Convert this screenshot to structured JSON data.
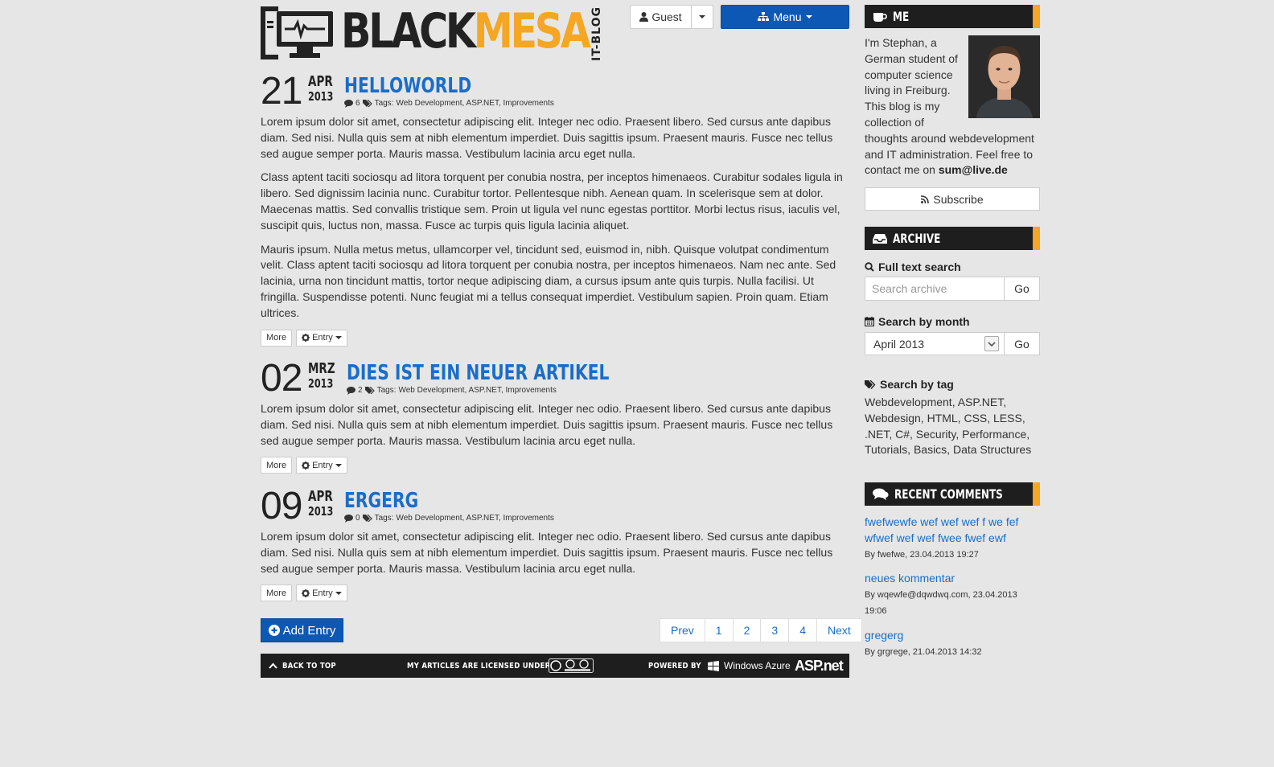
{
  "brand": {
    "black": "BLACK",
    "mesa": "MESA",
    "sub": "IT-BLOG"
  },
  "header": {
    "guest_label": "Guest",
    "menu_label": "Menu"
  },
  "posts": [
    {
      "day": "21",
      "month": "APR",
      "year": "2013",
      "title": "HELLOWORLD",
      "comments": "6",
      "tags_label": "Tags:",
      "tags": "Web Development, ASP.NET, Improvements",
      "paragraphs": [
        "Lorem ipsum dolor sit amet, consectetur adipiscing elit. Integer nec odio. Praesent libero. Sed cursus ante dapibus diam. Sed nisi. Nulla quis sem at nibh elementum imperdiet. Duis sagittis ipsum. Praesent mauris. Fusce nec tellus sed augue semper porta. Mauris massa. Vestibulum lacinia arcu eget nulla.",
        "Class aptent taciti sociosqu ad litora torquent per conubia nostra, per inceptos himenaeos. Curabitur sodales ligula in libero. Sed dignissim lacinia nunc. Curabitur tortor. Pellentesque nibh. Aenean quam. In scelerisque sem at dolor. Maecenas mattis. Sed convallis tristique sem. Proin ut ligula vel nunc egestas porttitor. Morbi lectus risus, iaculis vel, suscipit quis, luctus non, massa. Fusce ac turpis quis ligula lacinia aliquet.",
        "Mauris ipsum. Nulla metus metus, ullamcorper vel, tincidunt sed, euismod in, nibh. Quisque volutpat condimentum velit. Class aptent taciti sociosqu ad litora torquent per conubia nostra, per inceptos himenaeos. Nam nec ante. Sed lacinia, urna non tincidunt mattis, tortor neque adipiscing diam, a cursus ipsum ante quis turpis. Nulla facilisi. Ut fringilla. Suspendisse potenti. Nunc feugiat mi a tellus consequat imperdiet. Vestibulum sapien. Proin quam. Etiam ultrices."
      ],
      "more_label": "More",
      "entry_label": "Entry"
    },
    {
      "day": "02",
      "month": "MRZ",
      "year": "2013",
      "title": "DIES IST EIN NEUER ARTIKEL",
      "comments": "2",
      "tags_label": "Tags:",
      "tags": "Web Development, ASP.NET, Improvements",
      "paragraphs": [
        "Lorem ipsum dolor sit amet, consectetur adipiscing elit. Integer nec odio. Praesent libero. Sed cursus ante dapibus diam. Sed nisi. Nulla quis sem at nibh elementum imperdiet. Duis sagittis ipsum. Praesent mauris. Fusce nec tellus sed augue semper porta. Mauris massa. Vestibulum lacinia arcu eget nulla."
      ],
      "more_label": "More",
      "entry_label": "Entry"
    },
    {
      "day": "09",
      "month": "APR",
      "year": "2013",
      "title": "ERGERG",
      "comments": "0",
      "tags_label": "Tags:",
      "tags": "Web Development, ASP.NET, Improvements",
      "paragraphs": [
        "Lorem ipsum dolor sit amet, consectetur adipiscing elit. Integer nec odio. Praesent libero. Sed cursus ante dapibus diam. Sed nisi. Nulla quis sem at nibh elementum imperdiet. Duis sagittis ipsum. Praesent mauris. Fusce nec tellus sed augue semper porta. Mauris massa. Vestibulum lacinia arcu eget nulla."
      ],
      "more_label": "More",
      "entry_label": "Entry"
    }
  ],
  "actions": {
    "add_entry": "Add Entry"
  },
  "pager": {
    "prev": "Prev",
    "pages": [
      "1",
      "2",
      "3",
      "4"
    ],
    "next": "Next"
  },
  "footer": {
    "back_to_top": "BACK TO TOP",
    "license": "MY ARTICLES ARE LICENSED UNDER",
    "powered": "POWERED BY",
    "azure": "Windows Azure",
    "aspnet": "ASP.net"
  },
  "sidebar": {
    "me": {
      "title": "ME",
      "bio": "I'm Stephan, a German student of computer science living in Freiburg. This blog is my collection of thoughts around webdevelopment and IT administration. Feel free to contact me on",
      "email": "sum@live.de",
      "subscribe": "Subscribe"
    },
    "archive": {
      "title": "ARCHIVE",
      "fulltext_label": "Full text search",
      "search_placeholder": "Search archive",
      "go": "Go",
      "month_label": "Search by month",
      "month_value": "April 2013",
      "tag_label": "Search by tag",
      "tags": "Webdevelopment, ASP.NET, Webdesign, HTML, CSS, LESS, .NET, C#, Security, Performance, Tutorials, Basics, Data Structures"
    },
    "recent": {
      "title": "RECENT COMMENTS",
      "items": [
        {
          "text": "fwefwewfe wef wef wef f we fef wfwef wef wef fwee fwef ewf",
          "by": "By fwefwe, 23.04.2013 19:27"
        },
        {
          "text": "neues kommentar",
          "by": "By wqewfe@dqwdwq.com, 23.04.2013 19:06"
        },
        {
          "text": "gregerg",
          "by": "By grgrege, 21.04.2013 14:32"
        }
      ]
    }
  },
  "colors": {
    "accent": "#f5a623",
    "primary": "#0e58b5",
    "link": "#1a6dc9",
    "dark": "#1e1e1e"
  }
}
